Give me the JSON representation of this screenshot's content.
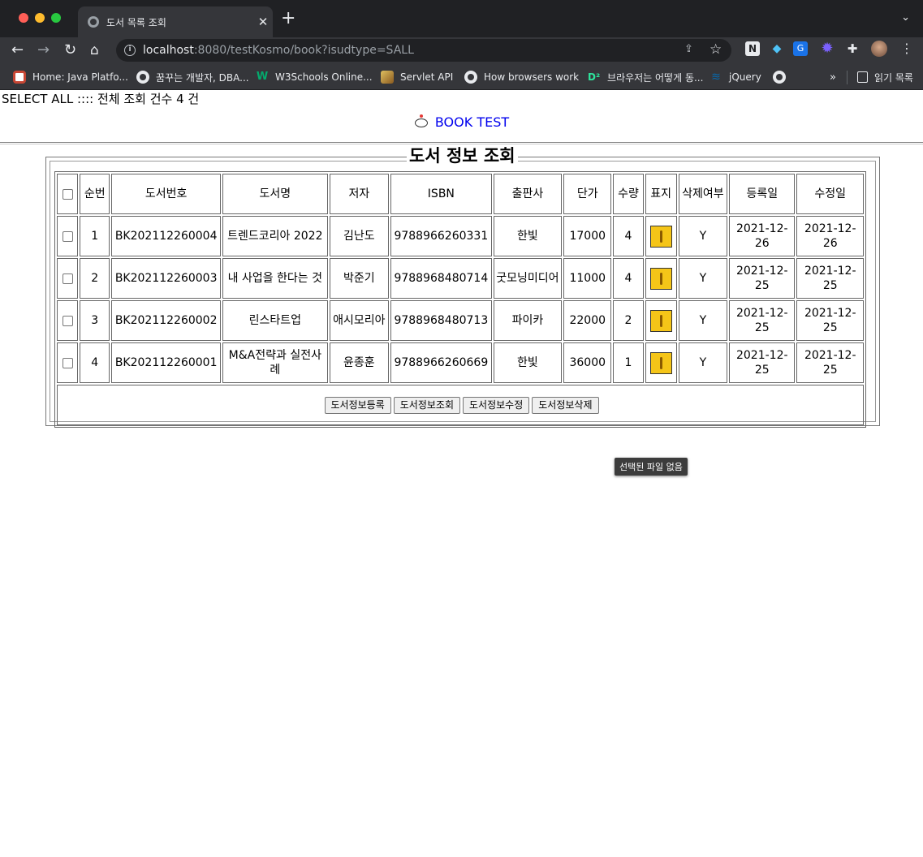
{
  "browser": {
    "tab_title": "도서 목록 조회",
    "url_host": "localhost",
    "url_rest": ":8080/testKosmo/book?isudtype=SALL",
    "bookmarks": [
      {
        "label": "Home: Java Platfo...",
        "icon": "oracle-icon"
      },
      {
        "label": "꿈꾸는 개발자, DBA...",
        "icon": "globe-icon"
      },
      {
        "label": "W3Schools Online...",
        "icon": "w3schools-icon"
      },
      {
        "label": "Servlet API",
        "icon": "servlet-icon"
      },
      {
        "label": "How browsers work",
        "icon": "globe-icon"
      },
      {
        "label": "브라우저는 어떻게 동...",
        "icon": "d2-icon"
      },
      {
        "label": "jQuery",
        "icon": "jquery-icon"
      }
    ],
    "more_label": "»",
    "reading_list_label": "읽기 목록"
  },
  "page": {
    "select_all_text": "SELECT ALL :::: 전체 조회 건수 4 건",
    "book_test_link": "BOOK TEST",
    "legend": "도서 정보 조회",
    "columns": [
      "순번",
      "도서번호",
      "도서명",
      "저자",
      "ISBN",
      "출판사",
      "단가",
      "수량",
      "표지",
      "삭제여부",
      "등록일",
      "수정일"
    ],
    "rows": [
      {
        "no": "1",
        "id": "BK202112260004",
        "title": "트렌드코리아 2022",
        "author": "김난도",
        "isbn": "9788966260331",
        "publisher": "한빛",
        "price": "17000",
        "qty": "4",
        "deleted": "Y",
        "reg": "2021-12-26",
        "mod": "2021-12-26"
      },
      {
        "no": "2",
        "id": "BK202112260003",
        "title": "내 사업을 한다는 것",
        "author": "박준기",
        "isbn": "9788968480714",
        "publisher": "굿모닝미디어",
        "price": "11000",
        "qty": "4",
        "deleted": "Y",
        "reg": "2021-12-25",
        "mod": "2021-12-25"
      },
      {
        "no": "3",
        "id": "BK202112260002",
        "title": "린스타트업",
        "author": "애시모리아",
        "isbn": "9788968480713",
        "publisher": "파이카",
        "price": "22000",
        "qty": "2",
        "deleted": "Y",
        "reg": "2021-12-25",
        "mod": "2021-12-25"
      },
      {
        "no": "4",
        "id": "BK202112260001",
        "title": "M&A전략과 실전사례",
        "author": "윤종훈",
        "isbn": "9788966260669",
        "publisher": "한빛",
        "price": "36000",
        "qty": "1",
        "deleted": "Y",
        "reg": "2021-12-25",
        "mod": "2021-12-25"
      }
    ],
    "buttons": {
      "insert": "도서정보등록",
      "select": "도서정보조회",
      "update": "도서정보수정",
      "delete": "도서정보삭제"
    },
    "tooltip": "선택된 파일 없음"
  }
}
